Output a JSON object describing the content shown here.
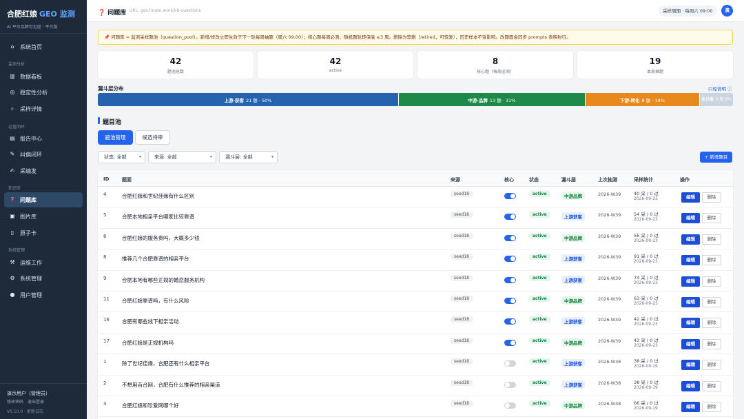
{
  "sidebar": {
    "brand_main": "合肥红娘",
    "brand_accent": "GEO 监测",
    "brand_sub": "AI 平台品牌可见度 · 平台版",
    "home": "系统首页",
    "sections": {
      "analysis": "监测分析",
      "ops_loop": "运营闭环",
      "knowledge": "知识库",
      "system": "系统管理"
    },
    "items": {
      "dashboard": "数据看板",
      "stability": "稳定性分析",
      "sampling": "采样详情",
      "reports": "报告中心",
      "correction": "纠偏闭环",
      "publish": "采编发",
      "questions": "问题库",
      "images": "图片库",
      "atoms": "原子卡",
      "ops_work": "运维工作",
      "sys_mgmt": "系统管理",
      "user_mgmt": "用户管理"
    },
    "user": "演示用户（管理员）",
    "change_pwd": "修改密码",
    "logout": "退出登录",
    "version": "V0.10.0 · 更新日志"
  },
  "topbar": {
    "title": "问题库",
    "url": "URL: geo.howai.work/kb-questions",
    "cycle": "采样周期 · 每周六 09:00",
    "avatar": "演"
  },
  "notice": "📌 问题库 = 监测采样题池（question_pool）。新增/修改立即生效于下一轮每周抽题（周六 09:00）；核心题每周必测，随机题轮转保底 ≥3 周。删除为软删（retired，可恢复），历史样本不受影响。改题面会同步 prompts 表映射行。",
  "stats": [
    {
      "num": "42",
      "label": "题池总数"
    },
    {
      "num": "42",
      "label": "active"
    },
    {
      "num": "8",
      "label": "核心题（每周必测）"
    },
    {
      "num": "19",
      "label": "本周抽题"
    }
  ],
  "funnel": {
    "title": "漏斗层分布",
    "help": "口径说明 ⓘ",
    "segments": [
      {
        "name": "上游·获客",
        "detail": "21 题 · 50%",
        "pct": 50,
        "type": "up"
      },
      {
        "name": "中游·品牌",
        "detail": "13 题 · 31%",
        "pct": 31,
        "type": "mid"
      },
      {
        "name": "下游·转化",
        "detail": "8 题 · 19%",
        "pct": 19,
        "type": "down"
      },
      {
        "name": "未分层",
        "detail": "0 题 0%",
        "pct": 5.5,
        "type": "none"
      }
    ]
  },
  "pool": {
    "title": "题目池",
    "tabs": [
      "题池管理",
      "候选待审"
    ],
    "filters": [
      "状态: 全部",
      "来源: 全部",
      "漏斗层: 全部"
    ],
    "add_button": "+ 新增题目"
  },
  "table": {
    "columns": [
      "ID",
      "题面",
      "来源",
      "核心",
      "状态",
      "漏斗层",
      "上次抽测",
      "采样统计",
      "操作"
    ],
    "edit_label": "编辑",
    "delete_label": "删除",
    "rows": [
      {
        "id": "4",
        "q": "合肥红娘和世纪佳缘有什么区别",
        "src": "seed18",
        "core": true,
        "status": "active",
        "layer": "中游品牌",
        "layer_type": "mid",
        "week": "2026-W39",
        "stat": "40 采 / 0 过",
        "date": "2026-09-23"
      },
      {
        "id": "5",
        "q": "合肥本地相亲平台哪家比较靠谱",
        "src": "seed18",
        "core": true,
        "status": "active",
        "layer": "上游获客",
        "layer_type": "up",
        "week": "2026-W39",
        "stat": "54 采 / 0 过",
        "date": "2026-09-23"
      },
      {
        "id": "6",
        "q": "合肥红娘的服务贵吗，大概多少钱",
        "src": "seed18",
        "core": true,
        "status": "active",
        "layer": "中游品牌",
        "layer_type": "mid",
        "week": "2026-W39",
        "stat": "56 采 / 0 过",
        "date": "2026-09-23"
      },
      {
        "id": "8",
        "q": "推荐几个合肥靠谱的相亲平台",
        "src": "seed18",
        "core": true,
        "status": "active",
        "layer": "上游获客",
        "layer_type": "up",
        "week": "2026-W39",
        "stat": "91 采 / 0 过",
        "date": "2026-09-23"
      },
      {
        "id": "9",
        "q": "合肥本地有哪些正规的婚恋服务机构",
        "src": "seed18",
        "core": true,
        "status": "active",
        "layer": "上游获客",
        "layer_type": "up",
        "week": "2026-W39",
        "stat": "74 采 / 0 过",
        "date": "2026-09-23"
      },
      {
        "id": "11",
        "q": "合肥红娘靠谱吗，有什么风险",
        "src": "seed18",
        "core": true,
        "status": "active",
        "layer": "中游品牌",
        "layer_type": "mid",
        "week": "2026-W39",
        "stat": "63 采 / 0 过",
        "date": "2026-09-23"
      },
      {
        "id": "16",
        "q": "合肥有哪些线下相亲活动",
        "src": "seed18",
        "core": true,
        "status": "active",
        "layer": "上游获客",
        "layer_type": "up",
        "week": "2026-W39",
        "stat": "42 采 / 0 过",
        "date": "2026-09-23"
      },
      {
        "id": "17",
        "q": "合肥红娘是正规机构吗",
        "src": "seed18",
        "core": true,
        "status": "active",
        "layer": "中游品牌",
        "layer_type": "mid",
        "week": "2026-W39",
        "stat": "43 采 / 0 过",
        "date": "2026-09-23"
      },
      {
        "id": "1",
        "q": "除了世纪佳缘，合肥还有什么相亲平台",
        "src": "seed18",
        "core": false,
        "status": "active",
        "layer": "上游获客",
        "layer_type": "up",
        "week": "2026-W38",
        "stat": "38 采 / 0 过",
        "date": "2026-09-19"
      },
      {
        "id": "2",
        "q": "不想用百合网，合肥有什么推荐的相亲渠道",
        "src": "seed18",
        "core": false,
        "status": "active",
        "layer": "上游获客",
        "layer_type": "up",
        "week": "2026-W38",
        "stat": "38 采 / 0 过",
        "date": "2026-09-19"
      },
      {
        "id": "3",
        "q": "合肥红娘和珍爱网哪个好",
        "src": "seed18",
        "core": false,
        "status": "active",
        "layer": "中游品牌",
        "layer_type": "mid",
        "week": "2026-W38",
        "stat": "66 采 / 0 过",
        "date": "2026-09-19"
      }
    ]
  }
}
